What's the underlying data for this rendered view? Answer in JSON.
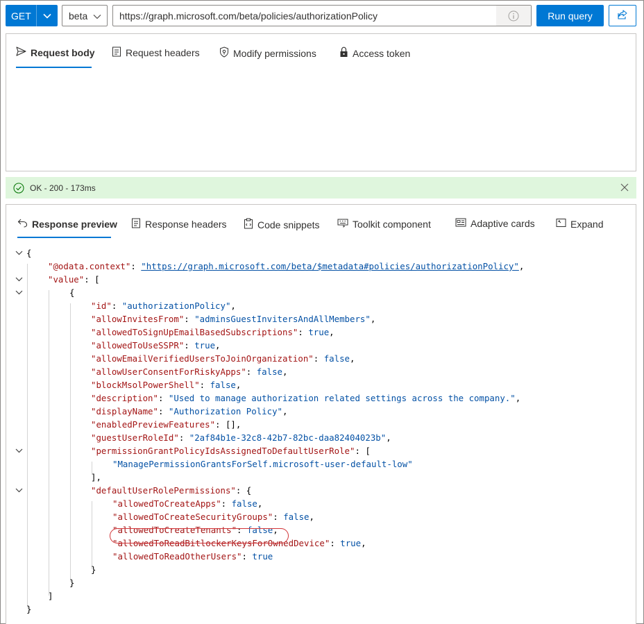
{
  "toolbar": {
    "method": "GET",
    "version": "beta",
    "url": "https://graph.microsoft.com/beta/policies/authorizationPolicy",
    "run_label": "Run query"
  },
  "request_tabs": [
    {
      "label": "Request body",
      "icon": "send-icon"
    },
    {
      "label": "Request headers",
      "icon": "document-icon"
    },
    {
      "label": "Modify permissions",
      "icon": "shield-key-icon"
    },
    {
      "label": "Access token",
      "icon": "lock-icon"
    }
  ],
  "status": {
    "text": "OK - 200 - 173ms",
    "color": "#dff6dd"
  },
  "response_tabs": [
    {
      "label": "Response preview",
      "icon": "undo-icon"
    },
    {
      "label": "Response headers",
      "icon": "document-icon"
    },
    {
      "label": "Code snippets",
      "icon": "clipboard-icon"
    },
    {
      "label": "Toolkit component",
      "icon": "keyboard-icon"
    },
    {
      "label": "Adaptive cards",
      "icon": "card-icon"
    },
    {
      "label": "Expand",
      "icon": "expand-icon"
    }
  ],
  "json_lines": [
    {
      "t": [
        [
          "p",
          "{"
        ]
      ]
    },
    {
      "t": [
        [
          "k",
          "\"@odata.context\""
        ],
        [
          "p",
          ": "
        ],
        [
          "lnk",
          "\"https://graph.microsoft.com/beta/$metadata#policies/authorizationPolicy\""
        ],
        [
          "p",
          ","
        ]
      ]
    },
    {
      "t": [
        [
          "k",
          "\"value\""
        ],
        [
          "p",
          ": ["
        ]
      ]
    },
    {
      "t": [
        [
          "p",
          "{"
        ]
      ]
    },
    {
      "t": [
        [
          "k",
          "\"id\""
        ],
        [
          "p",
          ": "
        ],
        [
          "s",
          "\"authorizationPolicy\""
        ],
        [
          "p",
          ","
        ]
      ]
    },
    {
      "t": [
        [
          "k",
          "\"allowInvitesFrom\""
        ],
        [
          "p",
          ": "
        ],
        [
          "s",
          "\"adminsGuestInvitersAndAllMembers\""
        ],
        [
          "p",
          ","
        ]
      ]
    },
    {
      "t": [
        [
          "k",
          "\"allowedToSignUpEmailBasedSubscriptions\""
        ],
        [
          "p",
          ": "
        ],
        [
          "b",
          "true"
        ],
        [
          "p",
          ","
        ]
      ]
    },
    {
      "t": [
        [
          "k",
          "\"allowedToUseSSPR\""
        ],
        [
          "p",
          ": "
        ],
        [
          "b",
          "true"
        ],
        [
          "p",
          ","
        ]
      ]
    },
    {
      "t": [
        [
          "k",
          "\"allowEmailVerifiedUsersToJoinOrganization\""
        ],
        [
          "p",
          ": "
        ],
        [
          "b",
          "false"
        ],
        [
          "p",
          ","
        ]
      ]
    },
    {
      "t": [
        [
          "k",
          "\"allowUserConsentForRiskyApps\""
        ],
        [
          "p",
          ": "
        ],
        [
          "b",
          "false"
        ],
        [
          "p",
          ","
        ]
      ]
    },
    {
      "t": [
        [
          "k",
          "\"blockMsolPowerShell\""
        ],
        [
          "p",
          ": "
        ],
        [
          "b",
          "false"
        ],
        [
          "p",
          ","
        ]
      ]
    },
    {
      "t": [
        [
          "k",
          "\"description\""
        ],
        [
          "p",
          ": "
        ],
        [
          "s",
          "\"Used to manage authorization related settings across the company.\""
        ],
        [
          "p",
          ","
        ]
      ]
    },
    {
      "t": [
        [
          "k",
          "\"displayName\""
        ],
        [
          "p",
          ": "
        ],
        [
          "s",
          "\"Authorization Policy\""
        ],
        [
          "p",
          ","
        ]
      ]
    },
    {
      "t": [
        [
          "k",
          "\"enabledPreviewFeatures\""
        ],
        [
          "p",
          ": [],"
        ]
      ]
    },
    {
      "t": [
        [
          "k",
          "\"guestUserRoleId\""
        ],
        [
          "p",
          ": "
        ],
        [
          "s",
          "\"2af84b1e-32c8-42b7-82bc-daa82404023b\""
        ],
        [
          "p",
          ","
        ]
      ]
    },
    {
      "t": [
        [
          "k",
          "\"permissionGrantPolicyIdsAssignedToDefaultUserRole\""
        ],
        [
          "p",
          ": ["
        ]
      ]
    },
    {
      "t": [
        [
          "s",
          "\"ManagePermissionGrantsForSelf.microsoft-user-default-low\""
        ]
      ]
    },
    {
      "t": [
        [
          "p",
          "],"
        ]
      ]
    },
    {
      "t": [
        [
          "k",
          "\"defaultUserRolePermissions\""
        ],
        [
          "p",
          ": {"
        ]
      ]
    },
    {
      "t": [
        [
          "k",
          "\"allowedToCreateApps\""
        ],
        [
          "p",
          ": "
        ],
        [
          "b",
          "false"
        ],
        [
          "p",
          ","
        ]
      ]
    },
    {
      "t": [
        [
          "k",
          "\"allowedToCreateSecurityGroups\""
        ],
        [
          "p",
          ": "
        ],
        [
          "b",
          "false"
        ],
        [
          "p",
          ","
        ]
      ]
    },
    {
      "t": [
        [
          "k",
          "\"allowedToCreateTenants\""
        ],
        [
          "p",
          ": "
        ],
        [
          "b",
          "false"
        ],
        [
          "p",
          ","
        ]
      ]
    },
    {
      "t": [
        [
          "k",
          "\"allowedToReadBitlockerKeysForOwnedDevice\""
        ],
        [
          "p",
          ": "
        ],
        [
          "b",
          "true"
        ],
        [
          "p",
          ","
        ]
      ]
    },
    {
      "t": [
        [
          "k",
          "\"allowedToReadOtherUsers\""
        ],
        [
          "p",
          ": "
        ],
        [
          "b",
          "true"
        ]
      ]
    },
    {
      "t": [
        [
          "p",
          "}"
        ]
      ]
    },
    {
      "t": [
        [
          "p",
          "}"
        ]
      ]
    },
    {
      "t": [
        [
          "p",
          "]"
        ]
      ]
    },
    {
      "t": [
        [
          "p",
          "}"
        ]
      ]
    }
  ],
  "highlight_color": "#d13438"
}
